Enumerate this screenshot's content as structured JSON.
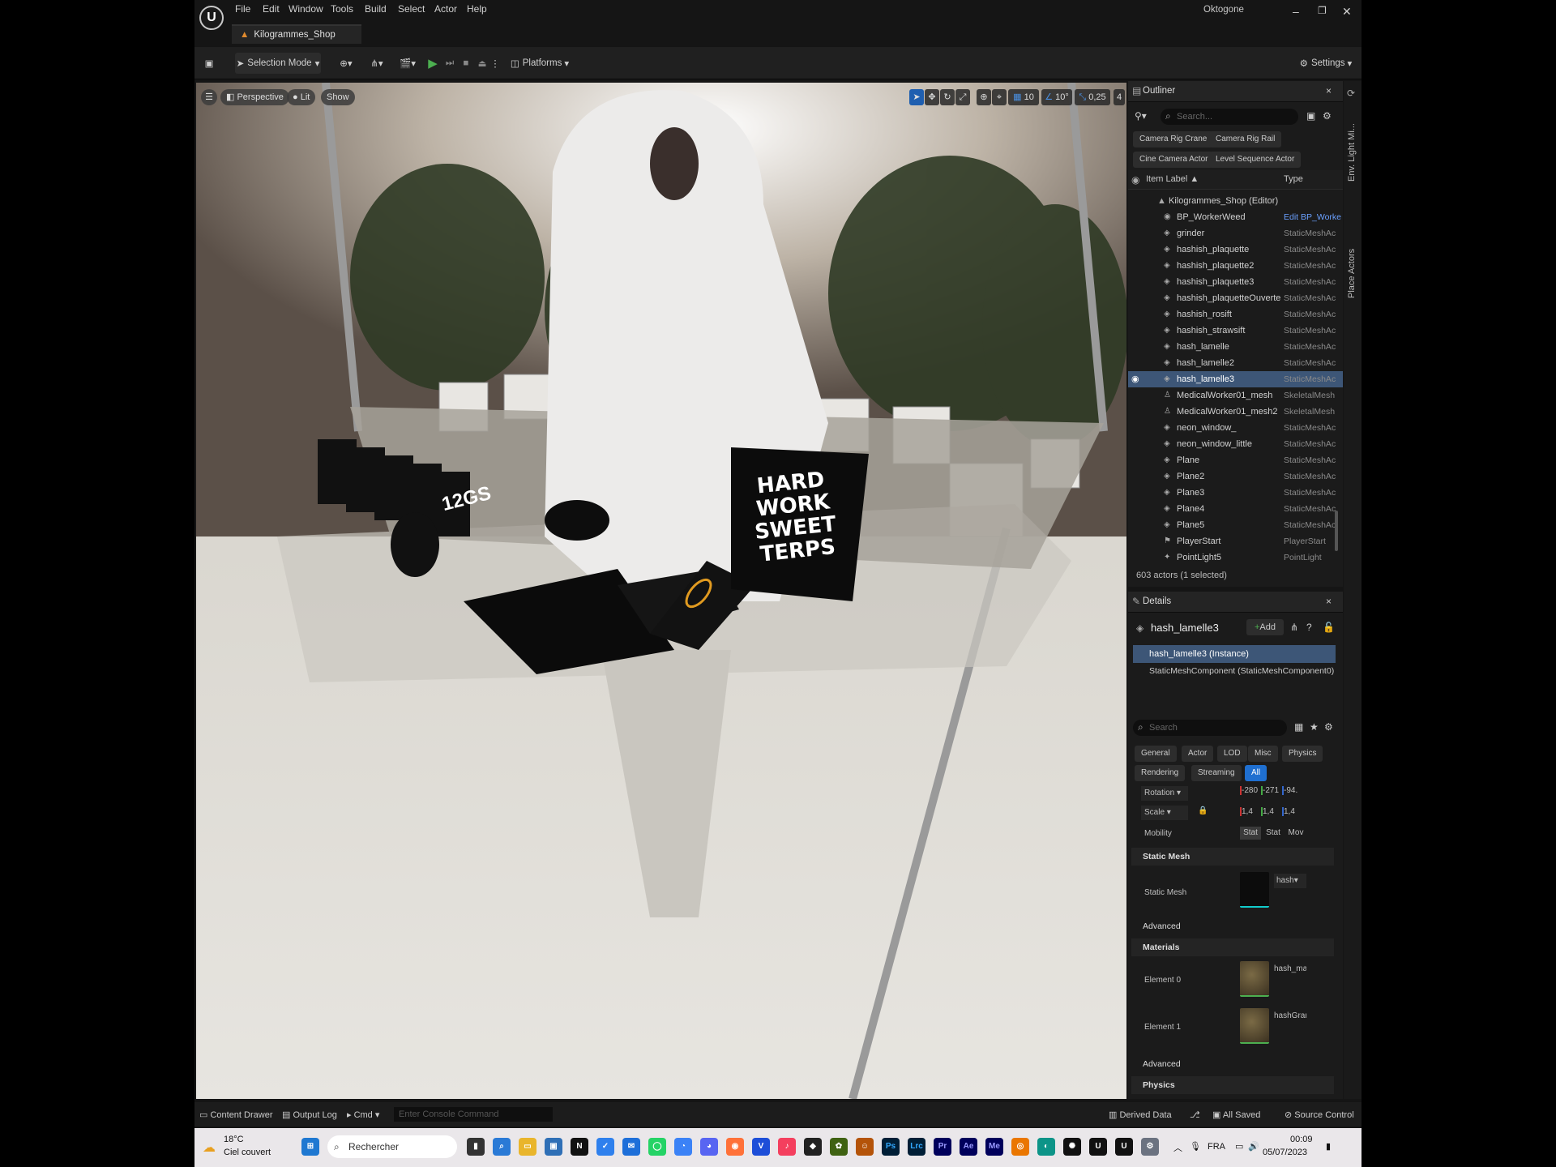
{
  "menu": {
    "logo": "U",
    "items": [
      "File",
      "Edit",
      "Window",
      "Tools",
      "Build",
      "Select",
      "Actor",
      "Help"
    ],
    "project_tab": "Kilogrammes_Shop",
    "user": "Oktogone",
    "window_controls": [
      "–",
      "❐",
      "✕"
    ]
  },
  "toolbar": {
    "selection_mode": "Selection Mode",
    "platforms": "Platforms",
    "settings": "Settings"
  },
  "viewport": {
    "perspective": "Perspective",
    "lit": "Lit",
    "show": "Show",
    "grid_snap": "10",
    "angle_snap": "10°",
    "scale_snap": "0,25",
    "camera_speed": "4",
    "scene": {
      "bag_line1": "HARD WORK",
      "bag_line2": "SWEET TERPS",
      "card_text": "12GS"
    }
  },
  "outliner": {
    "title": "Outliner",
    "search_placeholder": "Search...",
    "quick_add": [
      "Camera Rig Crane",
      "Camera Rig Rail",
      "Cine Camera Actor",
      "Level Sequence Actor"
    ],
    "col_label": "Item Label ▲",
    "col_type": "Type",
    "level_row": "Kilogrammes_Shop (Editor)",
    "rows": [
      {
        "name": "BP_WorkerWeed",
        "type": "Edit BP_Worke"
      },
      {
        "name": "grinder",
        "type": "StaticMeshAc"
      },
      {
        "name": "hashish_plaquette",
        "type": "StaticMeshAc"
      },
      {
        "name": "hashish_plaquette2",
        "type": "StaticMeshAc"
      },
      {
        "name": "hashish_plaquette3",
        "type": "StaticMeshAc"
      },
      {
        "name": "hashish_plaquetteOuverte",
        "type": "StaticMeshAc"
      },
      {
        "name": "hashish_rosift",
        "type": "StaticMeshAc"
      },
      {
        "name": "hashish_strawsift",
        "type": "StaticMeshAc"
      },
      {
        "name": "hash_lamelle",
        "type": "StaticMeshAc"
      },
      {
        "name": "hash_lamelle2",
        "type": "StaticMeshAc"
      },
      {
        "name": "hash_lamelle3",
        "type": "StaticMeshAc"
      },
      {
        "name": "MedicalWorker01_mesh",
        "type": "SkeletalMesh"
      },
      {
        "name": "MedicalWorker01_mesh2",
        "type": "SkeletalMesh"
      },
      {
        "name": "neon_window_",
        "type": "StaticMeshAc"
      },
      {
        "name": "neon_window_little",
        "type": "StaticMeshAc"
      },
      {
        "name": "Plane",
        "type": "StaticMeshAc"
      },
      {
        "name": "Plane2",
        "type": "StaticMeshAc"
      },
      {
        "name": "Plane3",
        "type": "StaticMeshAc"
      },
      {
        "name": "Plane4",
        "type": "StaticMeshAc"
      },
      {
        "name": "Plane5",
        "type": "StaticMeshAc"
      },
      {
        "name": "PlayerStart",
        "type": "PlayerStart"
      },
      {
        "name": "PointLight5",
        "type": "PointLight"
      }
    ],
    "footer": "603 actors (1 selected)"
  },
  "details": {
    "title": "Details",
    "actor_name": "hash_lamelle3",
    "add_label": "Add",
    "instance_row": "hash_lamelle3 (Instance)",
    "component_row": "StaticMeshComponent (StaticMeshComponent0)",
    "search_placeholder": "Search",
    "filter_tabs": [
      "General",
      "Actor",
      "LOD",
      "Misc",
      "Physics",
      "Rendering",
      "Streaming",
      "All"
    ],
    "rotation_label": "Rotation",
    "rotation_values": [
      "-280",
      "-271",
      "-94."
    ],
    "scale_label": "Scale",
    "scale_values": [
      "1,4",
      "1,4",
      "1,4"
    ],
    "mobility_label": "Mobility",
    "mobility_options": [
      "Stat",
      "Stat",
      "Mov"
    ],
    "static_mesh_section": "Static Mesh",
    "static_mesh_label": "Static Mesh",
    "static_mesh_value": "hash",
    "advanced_label": "Advanced",
    "materials_section": "Materials",
    "element0_label": "Element 0",
    "element0_value": "hash_mat",
    "element1_label": "Element 1",
    "element1_value": "hashGranu",
    "advanced2_label": "Advanced",
    "physics_section": "Physics"
  },
  "side_tabs": [
    "Env. Light Mi...",
    "Place Actors"
  ],
  "statusbar": {
    "content_drawer": "Content Drawer",
    "output_log": "Output Log",
    "cmd": "Cmd",
    "console_placeholder": "Enter Console Command",
    "derived_data": "Derived Data",
    "all_saved": "All Saved",
    "source_control": "Source Control"
  },
  "taskbar": {
    "weather_temp": "18°C",
    "weather_desc": "Ciel couvert",
    "search_placeholder": "Rechercher",
    "lang": "FRA",
    "time": "00:09",
    "date": "05/07/2023"
  },
  "colors": {
    "accent_blue": "#3d5677",
    "play_green": "#4caf50",
    "tab_orange": "#e08a2e",
    "selected_filter": "#1f6fd0"
  }
}
